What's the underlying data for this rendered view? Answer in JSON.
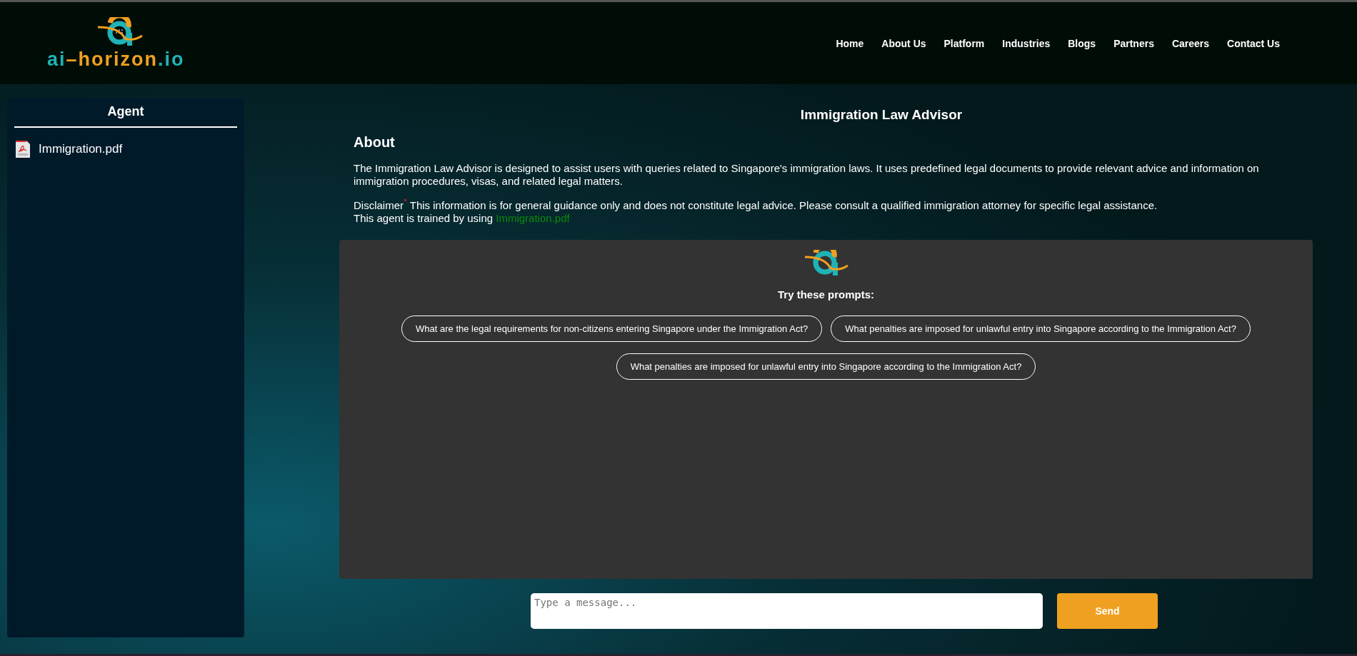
{
  "header": {
    "logo_parts": [
      {
        "text": "ai",
        "color": "#1fb3b8"
      },
      {
        "text": "–horizon",
        "color": "#f0a020"
      },
      {
        "text": ".io",
        "color": "#1fb3b8"
      }
    ],
    "nav": [
      {
        "label": "Home"
      },
      {
        "label": "About Us"
      },
      {
        "label": "Platform"
      },
      {
        "label": "Industries"
      },
      {
        "label": "Blogs"
      },
      {
        "label": "Partners"
      },
      {
        "label": "Careers"
      },
      {
        "label": "Contact Us"
      }
    ]
  },
  "sidebar": {
    "title": "Agent",
    "files": [
      {
        "name": "Immigration.pdf"
      }
    ]
  },
  "main": {
    "title": "Immigration Law Advisor",
    "about_heading": "About",
    "description": "The Immigration Law Advisor is designed to assist users with queries related to Singapore's immigration laws. It uses predefined legal documents to provide relevant advice and information on immigration procedures, visas, and related legal matters.",
    "disclaimer": {
      "label": "Disclaimer",
      "mark": "*",
      "text": " This information is for general guidance only and does not constitute legal advice. Please consult a qualified immigration attorney for specific legal assistance."
    },
    "trained": {
      "text": "This agent is trained by using ",
      "link": "Immigration.pdf"
    }
  },
  "chat": {
    "prompts_heading": "Try these prompts:",
    "prompts": [
      {
        "text": "What are the legal requirements for non-citizens entering Singapore under the Immigration Act?"
      },
      {
        "text": "What penalties are imposed for unlawful entry into Singapore according to the Immigration Act?"
      },
      {
        "text": "What penalties are imposed for unlawful entry into Singapore according to the Immigration Act?"
      }
    ]
  },
  "composer": {
    "placeholder": "Type a message...",
    "send": "Send"
  }
}
